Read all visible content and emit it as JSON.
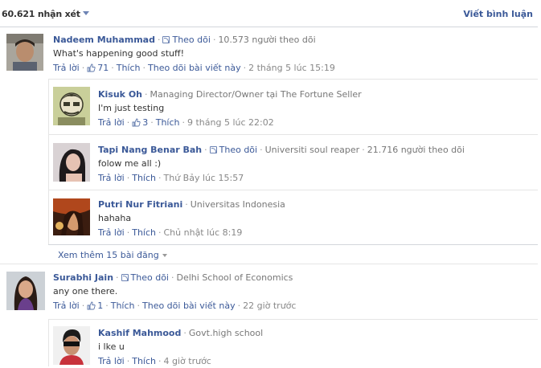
{
  "header": {
    "count": "60.621 nhận xét",
    "write_comment": "Viết bình luận"
  },
  "comments": [
    {
      "name": "Nadeem Muhammad",
      "follow": "Theo dõi",
      "meta": "10.573 người theo dõi",
      "text": "What's happening good stuff!",
      "actions": {
        "reply": "Trả lời",
        "likes": "71",
        "like": "Thích",
        "follow_post": "Theo dõi bài viết này",
        "time": "2 tháng 5 lúc 15:19"
      }
    },
    {
      "name": "Kisuk Oh",
      "meta": "Managing Director/Owner tại The Fortune Seller",
      "text": "I'm just testing",
      "actions": {
        "reply": "Trả lời",
        "likes": "3",
        "like": "Thích",
        "time": "9 tháng 5 lúc 22:02"
      }
    },
    {
      "name": "Tapi Nang Benar Bah",
      "follow": "Theo dõi",
      "meta": "Universiti soul reaper",
      "meta2": "21.716 người theo dõi",
      "text": "folow me all :)",
      "actions": {
        "reply": "Trả lời",
        "like": "Thích",
        "time": "Thứ Bảy lúc 15:57"
      }
    },
    {
      "name": "Putri Nur Fitriani",
      "meta": "Universitas Indonesia",
      "text": "hahaha",
      "actions": {
        "reply": "Trả lời",
        "like": "Thích",
        "time": "Chủ nhật lúc 8:19"
      }
    },
    {
      "name": "Surabhi Jain",
      "follow": "Theo dõi",
      "meta": "Delhi School of Economics",
      "text": "any one there.",
      "actions": {
        "reply": "Trả lời",
        "likes": "1",
        "like": "Thích",
        "follow_post": "Theo dõi bài viết này",
        "time": "22 giờ trước"
      }
    },
    {
      "name": "Kashif Mahmood",
      "meta": "Govt.high school",
      "text": "i lke u",
      "actions": {
        "reply": "Trả lời",
        "like": "Thích",
        "time": "4 giờ trước"
      }
    }
  ],
  "more_posts": "Xem thêm 15 bài đăng",
  "colors": {
    "link": "#3b5998",
    "meta": "#777777",
    "border": "#e5e5e5"
  }
}
